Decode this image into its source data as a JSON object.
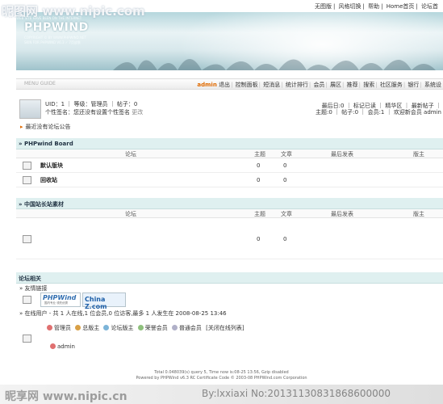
{
  "watermark": {
    "top": "昵图网 www.nipic.com",
    "top_sub": "OUR WEB SITE HAVE BEEN ON THE INTERNET",
    "bottom_left": "昵享网 www.nipic.cn",
    "bottom_right": "By:lxxiaxi No:20131130831868600000"
  },
  "toplinks": [
    "无图版",
    "风格切换",
    "帮助",
    "Home首页",
    "论坛首"
  ],
  "banner": {
    "title": "PHPWIND",
    "sub1": "COPYRIGHT © BY WWW.PHPWIND.NET",
    "sub2": "SKIN FOR PHPWIND V6.3 ✓ 7页皮肤"
  },
  "nav": {
    "guide": "MENU GUIDE",
    "user": "admin",
    "items": [
      "退出",
      "控制面板",
      "短消息",
      "统计排行",
      "会员",
      "展区",
      "推荐",
      "搜索",
      "社区服务",
      "银行",
      "系统设"
    ]
  },
  "userbox": {
    "line1": "UID：1 ｜ 等级：管理员 ｜ 帖子：0",
    "line2": "个性签名：您还没有设置个性签名",
    "line2_link": "更改",
    "right1": "最后日:0 ｜ 标记已读 ｜ 精华区 ｜ 最新帖子 ｜",
    "right2": "主题:0 ｜ 帖子:0 ｜ 会员:1 ｜ 欢迎新会员 admin"
  },
  "notice": "最近没有论坛公告",
  "col_headers": {
    "forum": "论坛",
    "topics": "主题",
    "posts": "文章",
    "last": "最后发表",
    "mod": "版主"
  },
  "board1": {
    "title": "» PHPwind Board",
    "forums": [
      {
        "name": "默认版块",
        "topics": "0",
        "posts": "0"
      },
      {
        "name": "回收站",
        "topics": "0",
        "posts": "0"
      }
    ]
  },
  "board2": {
    "title": "» 中国站长站素材",
    "forums": [
      {
        "name": "",
        "topics": "0",
        "posts": "0"
      }
    ]
  },
  "related": {
    "title": "论坛相关",
    "links_title": "» 友情链接",
    "logo1": "PHPWind",
    "logo1_sub": "国内专业 领先优秀",
    "logo2": "China Z.com",
    "online": "» 在线用户 - 共 1 人在线,1 位会员,0 位访客,最多 1 人发生在 2008-08-25 13:46",
    "legend": [
      "管理员",
      "总版主",
      "论坛版主",
      "荣誉会员",
      "普通会员"
    ],
    "legend_link": "[关闭在线列表]",
    "online_user": "admin"
  },
  "legend_colors": [
    "#e07070",
    "#d9a046",
    "#7cb4d8",
    "#8ec07c",
    "#b0b0c8"
  ],
  "footer": {
    "line1": "Total 0.048039(s) query 5, Time now is:08-25 13:56, Gzip disabled",
    "line2": "Powered by PHPWind v6.3 RC Certificate Code © 2003-08 PHPWind.com Corporation"
  }
}
